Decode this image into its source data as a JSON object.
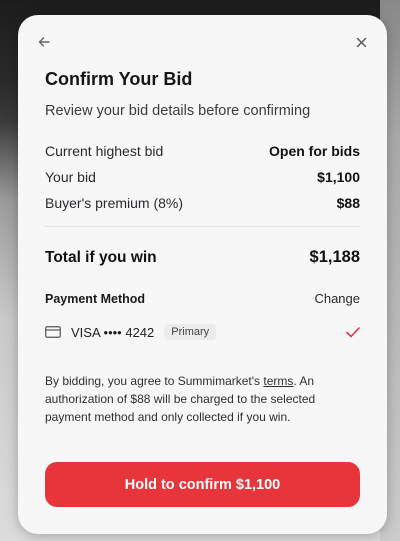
{
  "header": {
    "back_icon": "arrow-left-icon",
    "close_icon": "close-icon"
  },
  "title": "Confirm Your Bid",
  "subtitle": "Review your bid details before confirming",
  "summary": [
    {
      "label": "Current highest bid",
      "value": "Open for bids"
    },
    {
      "label": "Your bid",
      "value": "$1,100"
    },
    {
      "label": "Buyer's premium (8%)",
      "value": "$88"
    }
  ],
  "total": {
    "label": "Total if you win",
    "value": "$1,188"
  },
  "payment": {
    "label": "Payment Method",
    "change_label": "Change",
    "card_icon": "credit-card-icon",
    "card_text": "VISA •••• 4242",
    "badge": "Primary",
    "selected_icon": "checkmark-icon"
  },
  "legal": {
    "prefix": "By bidding, you agree to Summimarket's ",
    "terms_link": "terms",
    "suffix": ". An authorization of $88 will be charged to the selected payment method and only collected if you win."
  },
  "confirm_button": "Hold to confirm $1,100",
  "colors": {
    "accent": "#e8353b",
    "surface": "#f7f7f8"
  }
}
